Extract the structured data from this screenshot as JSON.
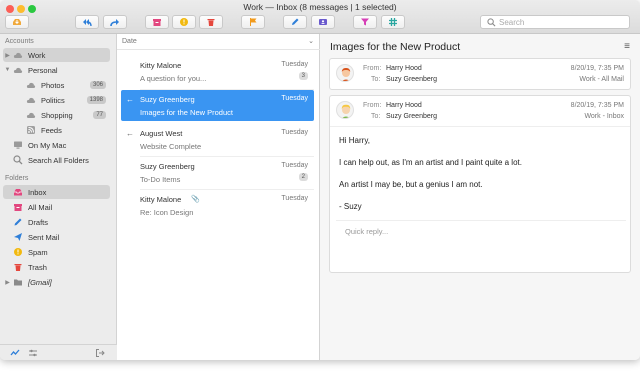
{
  "window": {
    "title": "Work — Inbox (8 messages | 1 selected)"
  },
  "toolbar": {
    "buttons": [
      {
        "name": "get-mail-icon",
        "color": "#f0a93c"
      },
      {
        "name": "reply-all-icon",
        "color": "#2f7fd8"
      },
      {
        "name": "forward-icon",
        "color": "#2f7fd8"
      },
      {
        "name": "archive-icon",
        "color": "#e2477f"
      },
      {
        "name": "junk-icon",
        "color": "#f2b90f"
      },
      {
        "name": "trash-icon",
        "color": "#e5473d"
      },
      {
        "name": "flag-icon",
        "color": "#f29b1d"
      },
      {
        "name": "compose-icon",
        "color": "#2f7fd8"
      },
      {
        "name": "contact-card-icon",
        "color": "#6a5acd"
      },
      {
        "name": "filter-icon",
        "color": "#d63fb6"
      },
      {
        "name": "tag-icon",
        "color": "#2aa6a0"
      }
    ],
    "search_placeholder": "Search"
  },
  "sidebar": {
    "accounts_header": "Accounts",
    "accounts": [
      {
        "label": "Work",
        "selected": true,
        "icon": "cloud-icon"
      },
      {
        "label": "Personal",
        "selected": false,
        "icon": "cloud-icon"
      },
      {
        "label": "Photos",
        "count": "306",
        "icon": "cloud-icon"
      },
      {
        "label": "Politics",
        "count": "1398",
        "icon": "cloud-icon"
      },
      {
        "label": "Shopping",
        "count": "77",
        "icon": "cloud-icon"
      },
      {
        "label": "Feeds",
        "icon": "rss-icon"
      },
      {
        "label": "On My Mac",
        "icon": "computer-icon"
      },
      {
        "label": "Search All Folders",
        "icon": "search-icon"
      }
    ],
    "folders_header": "Folders",
    "folders": [
      {
        "label": "Inbox",
        "selected": true,
        "icon": "inbox-icon",
        "color": "#e2477f"
      },
      {
        "label": "All Mail",
        "icon": "all-mail-icon",
        "color": "#e2477f"
      },
      {
        "label": "Drafts",
        "icon": "drafts-icon",
        "color": "#2f7fd8"
      },
      {
        "label": "Sent Mail",
        "icon": "sent-icon",
        "color": "#2f7fd8"
      },
      {
        "label": "Spam",
        "icon": "spam-icon",
        "color": "#f2b90f"
      },
      {
        "label": "Trash",
        "icon": "trash-icon",
        "color": "#e5473d"
      },
      {
        "label": "[Gmail]",
        "icon": "folder-icon",
        "color": "#8a8a8a"
      }
    ]
  },
  "message_list": {
    "sort_label": "Date",
    "messages": [
      {
        "from": "Kitty Malone",
        "subject": "A question for you...",
        "date": "Tuesday",
        "count": "3",
        "selected": false
      },
      {
        "from": "Suzy Greenberg",
        "subject": "Images for the New Product",
        "date": "Tuesday",
        "selected": true,
        "replied": true
      },
      {
        "from": "August West",
        "subject": "Website Complete",
        "date": "Tuesday",
        "replied": true
      },
      {
        "from": "Suzy Greenberg",
        "subject": "To-Do Items",
        "date": "Tuesday",
        "count": "2"
      },
      {
        "from": "Kitty Malone",
        "subject": "Re: Icon Design",
        "date": "Tuesday",
        "attachment": true
      }
    ]
  },
  "reader": {
    "subject": "Images for the New Product",
    "messages": [
      {
        "from_label": "From:",
        "from": "Harry Hood",
        "to_label": "To:",
        "to": "Suzy Greenberg",
        "date": "8/20/19, 7:35 PM",
        "folder": "Work - All Mail"
      },
      {
        "from_label": "From:",
        "from": "Harry Hood",
        "to_label": "To:",
        "to": "Suzy Greenberg",
        "date": "8/20/19, 7:35 PM",
        "folder": "Work - Inbox",
        "body": [
          "Hi Harry,",
          "I can help out, as I'm an artist and I paint quite a lot.",
          "An artist I may be, but a genius I am not.",
          "- Suzy"
        ],
        "quick_reply_placeholder": "Quick reply..."
      }
    ]
  }
}
